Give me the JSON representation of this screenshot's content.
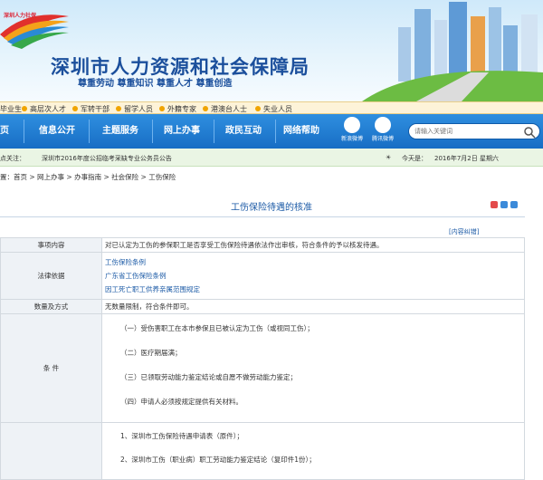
{
  "banner": {
    "logo_text": "深圳人力社保",
    "site_title": "深圳市人力资源和社会保障局",
    "slogan": "尊重劳动  尊重知识  尊重人才  尊重创造"
  },
  "audience": [
    "毕业生",
    "高层次人才",
    "军转干部",
    "留学人员",
    "外籍专家",
    "港澳台人士",
    "失业人员"
  ],
  "nav": {
    "items": [
      "信息公开",
      "主题服务",
      "网上办事",
      "政民互动",
      "网络帮助"
    ],
    "weibo_1": "新浪微博",
    "weibo_2": "腾讯微博",
    "search_placeholder": "请输入关键词"
  },
  "notice": {
    "label": "点关注：",
    "text": "深圳市2016年度公招临考采缺专业公务员公告",
    "today_label": "今天是：",
    "date": "2016年7月2日 星期六"
  },
  "breadcrumb": "置：首页 > 网上办事 > 办事指南 > 社会保险 > 工伤保险",
  "page": {
    "title": "工伤保险待遇的核准",
    "correction": "[内容纠错]"
  },
  "table": {
    "row1_label": "事项内容",
    "row1_value": "对已认定为工伤的参保职工是否享受工伤保险待遇依法作出审核，符合条件的予以核发待遇。",
    "row2_label": "法律依据",
    "row2_links": [
      "工伤保险条例",
      "广东省工伤保险条例",
      "因工死亡职工供养亲属范围规定"
    ],
    "row3_label": "数量及方式",
    "row3_value": "无数量限制，符合条件即可。",
    "row4_label": "条    件",
    "row4_items": [
      "（一）受伤害职工在本市参保且已被认定为工伤（或视同工伤）；",
      "（二）医疗期届满；",
      "（三）已领取劳动能力鉴定结论或自愿不做劳动能力鉴定；",
      "（四）申请人必须按规定提供有关材料。"
    ],
    "row5_items": [
      "1、深圳市工伤保险待遇申请表（原件）；",
      "2、深圳市工伤（职业病）职工劳动能力鉴定结论（复印件1份）；"
    ]
  },
  "colors": {
    "nav": "#1f78cf",
    "title": "#1b4f9c",
    "link": "#1b5aa6"
  }
}
